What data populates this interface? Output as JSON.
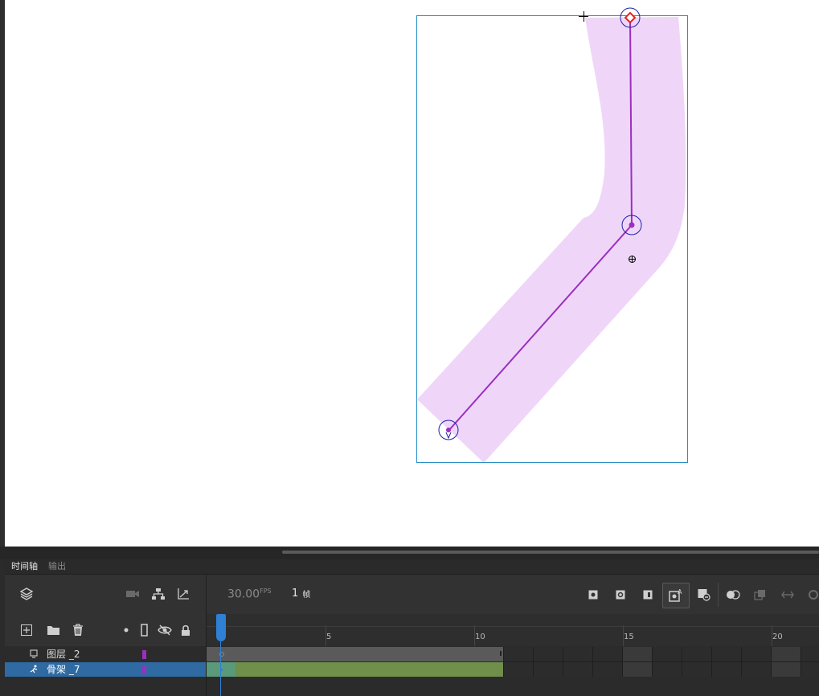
{
  "tabs": [
    {
      "label": "时间轴",
      "active": true
    },
    {
      "label": "输出",
      "active": false
    }
  ],
  "toolbar": {
    "layers_icon": "layers-icon",
    "camera_icon": "camera-icon",
    "parenting_icon": "parenting-icon",
    "graph_icon": "graph-icon",
    "fps_value": "30.00",
    "fps_unit": "FPS",
    "current_frame": "1",
    "frame_unit": "帧",
    "right_icons": [
      "insert-keyframe-icon",
      "insert-blank-keyframe-icon",
      "insert-frame-icon",
      "auto-keyframe-icon",
      "remove-frame-icon",
      "onion-skin-icon",
      "edit-multiple-frames-icon",
      "loop-icon",
      "more-icon"
    ]
  },
  "layer_tools": {
    "icons": [
      "new-layer-icon",
      "new-folder-icon",
      "delete-icon",
      "dot-icon",
      "outline-icon",
      "hide-icon",
      "lock-icon"
    ]
  },
  "ruler": {
    "labels": [
      "5",
      "10",
      "15",
      "20"
    ]
  },
  "layers": [
    {
      "name": "图层 _2",
      "icon": "layer-icon",
      "selected": false,
      "color": "#9b2fbf"
    },
    {
      "name": "骨架 _7",
      "icon": "armature-icon",
      "selected": true,
      "color": "#9b2fbf"
    }
  ],
  "colors": {
    "shape_fill": "#efd6f9",
    "bone": "#9b2fbf",
    "joint_ring": "#1f1fa8",
    "bounding_box": "#2a8fc7",
    "root_marker": "#e0251f",
    "selection_blue": "#2f6aa3",
    "tween_green": "#6f8f4a",
    "playhead": "#2f7fd4"
  }
}
